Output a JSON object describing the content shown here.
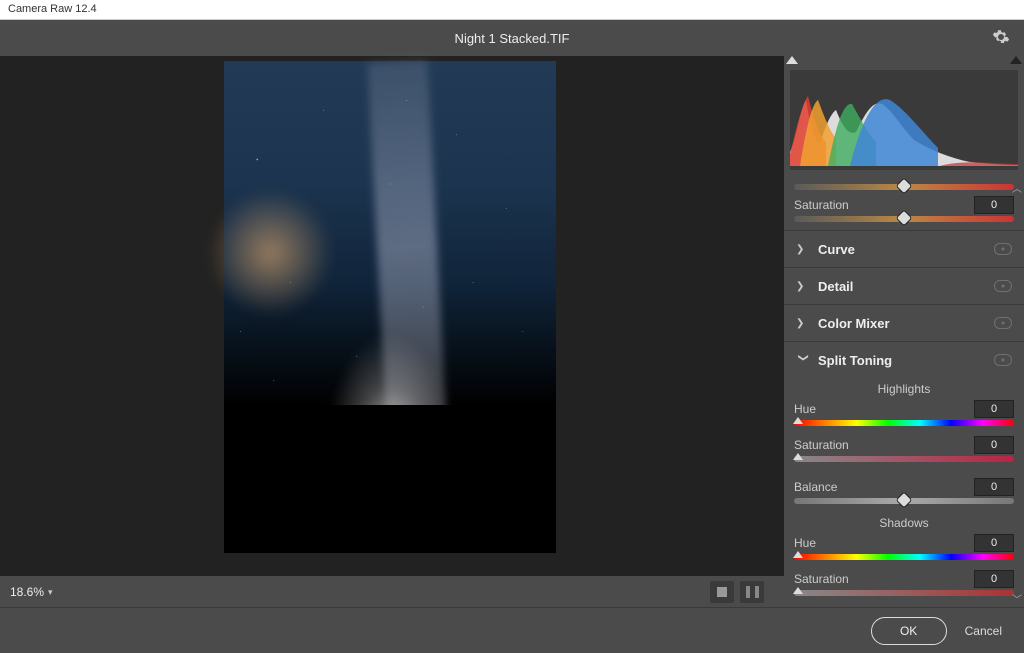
{
  "app_title": "Camera Raw 12.4",
  "filename": "Night 1 Stacked.TIF",
  "zoom": "18.6%",
  "top_slider": {
    "saturation_label": "Saturation",
    "saturation_value": "0"
  },
  "panels": {
    "curve": "Curve",
    "detail": "Detail",
    "color_mixer": "Color Mixer",
    "split_toning": "Split Toning"
  },
  "split_toning": {
    "highlights_label": "Highlights",
    "hue_label": "Hue",
    "hue_value": "0",
    "hl_sat_label": "Saturation",
    "hl_sat_value": "0",
    "balance_label": "Balance",
    "balance_value": "0",
    "shadows_label": "Shadows",
    "sh_hue_label": "Hue",
    "sh_hue_value": "0",
    "sh_sat_label": "Saturation",
    "sh_sat_value": "0"
  },
  "footer": {
    "ok": "OK",
    "cancel": "Cancel"
  }
}
